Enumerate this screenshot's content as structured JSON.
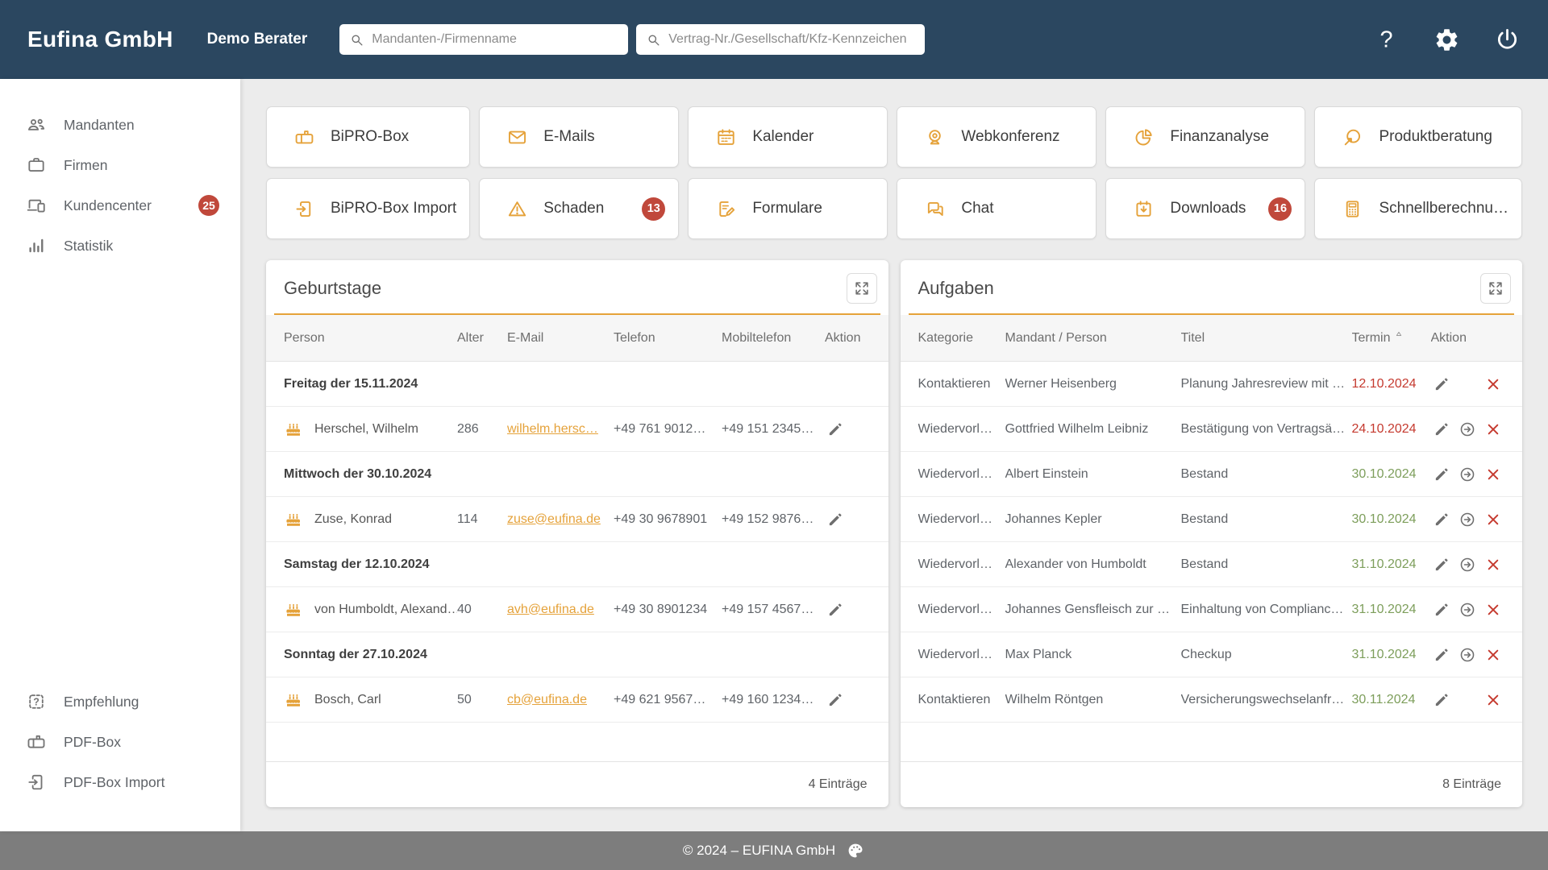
{
  "appbar": {
    "brand": "Eufina GmbH",
    "user": "Demo Berater",
    "search_client": {
      "placeholder": "Mandanten-/Firmenname"
    },
    "search_contract": {
      "placeholder": "Vertrag-Nr./Gesellschaft/Kfz-Kennzeichen"
    },
    "actions": [
      {
        "name": "help",
        "icon": "help"
      },
      {
        "name": "settings",
        "icon": "settings"
      },
      {
        "name": "power",
        "icon": "power"
      }
    ]
  },
  "sidebar": {
    "top_items": [
      {
        "label": "Mandanten",
        "icon": "people"
      },
      {
        "label": "Firmen",
        "icon": "briefcase"
      },
      {
        "label": "Kundencenter",
        "icon": "devices",
        "badge": "25"
      },
      {
        "label": "Statistik",
        "icon": "chart"
      }
    ],
    "bottom_items": [
      {
        "label": "Empfehlung",
        "icon": "recommendation"
      },
      {
        "label": "PDF-Box",
        "icon": "mailbox"
      },
      {
        "label": "PDF-Box Import",
        "icon": "import"
      }
    ]
  },
  "tiles": [
    {
      "label": "BiPRO-Box",
      "icon": "mailbox"
    },
    {
      "label": "E-Mails",
      "icon": "envelope"
    },
    {
      "label": "Kalender",
      "icon": "calendar"
    },
    {
      "label": "Webkonferenz",
      "icon": "webcam"
    },
    {
      "label": "Finanzanalyse",
      "icon": "pie"
    },
    {
      "label": "Produktberatung",
      "icon": "advice"
    },
    {
      "label": "BiPRO-Box Import",
      "icon": "import"
    },
    {
      "label": "Schaden",
      "icon": "warning",
      "badge": "13"
    },
    {
      "label": "Formulare",
      "icon": "form"
    },
    {
      "label": "Chat",
      "icon": "chat"
    },
    {
      "label": "Downloads",
      "icon": "download",
      "badge": "16"
    },
    {
      "label": "Schnellberechnu…",
      "icon": "calculator"
    }
  ],
  "birthdays": {
    "title": "Geburtstage",
    "columns": [
      "Person",
      "Alter",
      "E-Mail",
      "Telefon",
      "Mobiltelefon",
      "Aktion"
    ],
    "rows": [
      {
        "type": "group",
        "label": "Freitag der 15.11.2024"
      },
      {
        "type": "person",
        "name": "Herschel, Wilhelm",
        "alter": "286",
        "email": "wilhelm.hersc…",
        "telefon": "+49 761 9012…",
        "mobiltelefon": "+49 151 2345…"
      },
      {
        "type": "group",
        "label": "Mittwoch der 30.10.2024"
      },
      {
        "type": "person",
        "name": "Zuse, Konrad",
        "alter": "114",
        "email": "zuse@eufina.de",
        "telefon": "+49 30 9678901",
        "mobiltelefon": "+49 152 9876…"
      },
      {
        "type": "group",
        "label": "Samstag der 12.10.2024"
      },
      {
        "type": "person",
        "name": "von Humboldt, Alexand…",
        "alter": "40",
        "email": "avh@eufina.de",
        "telefon": "+49 30 8901234",
        "mobiltelefon": "+49 157 4567…"
      },
      {
        "type": "group",
        "label": "Sonntag der 27.10.2024"
      },
      {
        "type": "person",
        "name": "Bosch, Carl",
        "alter": "50",
        "email": "cb@eufina.de",
        "telefon": "+49 621 9567…",
        "mobiltelefon": "+49 160 1234…"
      }
    ],
    "footer": "4 Einträge"
  },
  "tasks": {
    "title": "Aufgaben",
    "columns": [
      "Kategorie",
      "Mandant / Person",
      "Titel",
      "Termin",
      "Aktion"
    ],
    "sorted_column": "Termin",
    "rows": [
      {
        "kategorie": "Kontaktieren",
        "person": "Werner Heisenberg",
        "titel": "Planung Jahresreview mit …",
        "termin": "12.10.2024",
        "termin_status": "overdue",
        "forward": false
      },
      {
        "kategorie": "Wiedervorl…",
        "person": "Gottfried Wilhelm Leibniz",
        "titel": "Bestätigung von Vertragsä…",
        "termin": "24.10.2024",
        "termin_status": "overdue",
        "forward": true
      },
      {
        "kategorie": "Wiedervorl…",
        "person": "Albert Einstein",
        "titel": "Bestand",
        "termin": "30.10.2024",
        "termin_status": "upcoming",
        "forward": true
      },
      {
        "kategorie": "Wiedervorl…",
        "person": "Johannes Kepler",
        "titel": "Bestand",
        "termin": "30.10.2024",
        "termin_status": "upcoming",
        "forward": true
      },
      {
        "kategorie": "Wiedervorl…",
        "person": "Alexander von Humboldt",
        "titel": "Bestand",
        "termin": "31.10.2024",
        "termin_status": "upcoming",
        "forward": true
      },
      {
        "kategorie": "Wiedervorl…",
        "person": "Johannes Gensfleisch zur …",
        "titel": "Einhaltung von Compliance…",
        "termin": "31.10.2024",
        "termin_status": "upcoming",
        "forward": true
      },
      {
        "kategorie": "Wiedervorl…",
        "person": "Max Planck",
        "titel": "Checkup",
        "termin": "31.10.2024",
        "termin_status": "upcoming",
        "forward": true
      },
      {
        "kategorie": "Kontaktieren",
        "person": "Wilhelm Röntgen",
        "titel": "Versicherungswechselanfr…",
        "termin": "30.11.2024",
        "termin_status": "upcoming",
        "forward": false
      }
    ],
    "footer": "8 Einträge"
  },
  "page_footer": {
    "copyright": "© 2024 – EUFINA GmbH"
  },
  "colors": {
    "header": "#2b4760",
    "accent": "#e5a23a",
    "badge": "#c0483b",
    "date_red": "#c53a2f",
    "date_green": "#7d9e5b",
    "footer": "#7d7d7d"
  }
}
